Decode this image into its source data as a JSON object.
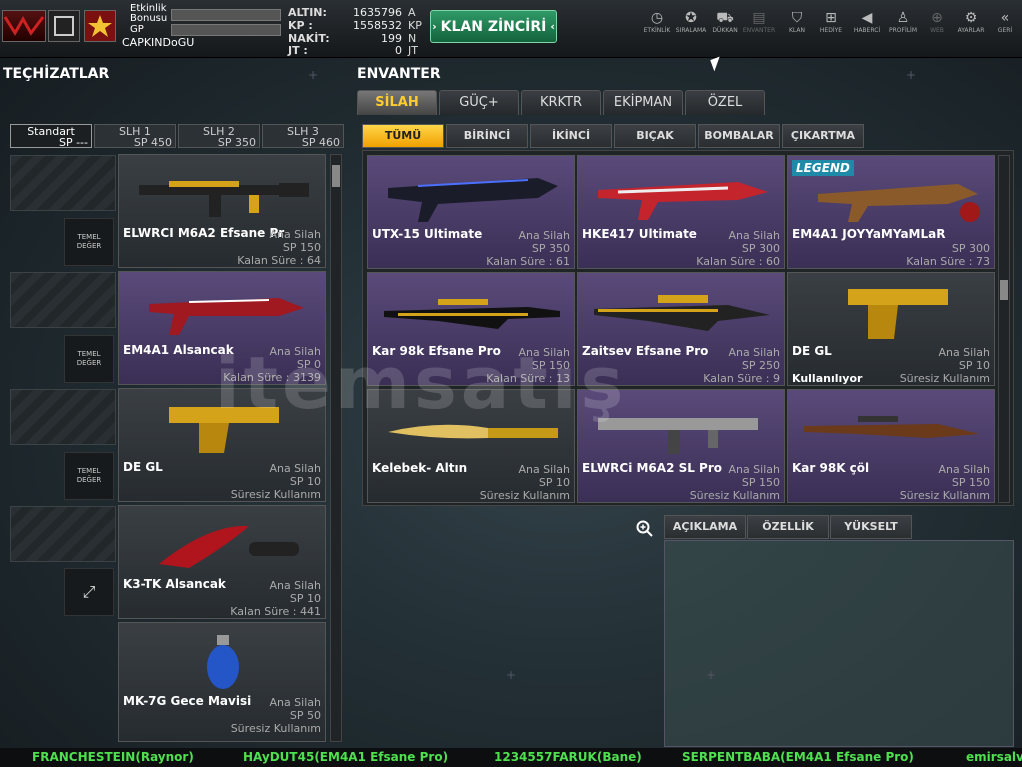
{
  "header": {
    "bonus_label": "Etkinlik Bonusu",
    "gp_label": "GP",
    "username": "CAPKINDoGU",
    "currencies": [
      {
        "label": "ALTIN:",
        "value": "1635796",
        "unit": "A"
      },
      {
        "label": "KP   :",
        "value": "1558532",
        "unit": "KP"
      },
      {
        "label": "NAKİT:",
        "value": "199",
        "unit": "N"
      },
      {
        "label": "JT   :",
        "value": "0",
        "unit": "JT"
      }
    ],
    "klan_button": "KLAN ZİNCİRİ",
    "nav": [
      "ETKİNLİK",
      "SIRALAMA",
      "DÜKKAN",
      "ENVANTER",
      "KLAN",
      "HEDİYE",
      "HABERCİ",
      "PROFİLİM",
      "WEB",
      "AYARLAR",
      "GERİ"
    ]
  },
  "left": {
    "title": "TEÇHİZATLAR",
    "slot_tabs": [
      {
        "name": "Standart",
        "sp": "SP ---"
      },
      {
        "name": "SLH 1",
        "sp": "SP 450"
      },
      {
        "name": "SLH 2",
        "sp": "SP 350"
      },
      {
        "name": "SLH 3",
        "sp": "SP 460"
      }
    ],
    "temel_label": "TEMEL DEĞER",
    "items": [
      {
        "name": "ELWRCI M6A2 Efsane Pr",
        "type": "Ana Silah",
        "sp": "SP 150",
        "time": "Kalan Süre : 64"
      },
      {
        "name": "EM4A1 Alsancak",
        "type": "Ana Silah",
        "sp": "SP 0",
        "time": "Kalan Süre : 3139"
      },
      {
        "name": "DE GL",
        "type": "Ana Silah",
        "sp": "SP 10",
        "time": "Süresiz Kullanım"
      },
      {
        "name": "K3-TK Alsancak",
        "type": "Ana Silah",
        "sp": "SP 10",
        "time": "Kalan Süre : 441"
      },
      {
        "name": "MK-7G Gece Mavisi",
        "type": "Ana Silah",
        "sp": "SP 50",
        "time": "Süresiz Kullanım"
      }
    ]
  },
  "inventory": {
    "title": "ENVANTER",
    "tabs": [
      "SİLAH",
      "GÜÇ+",
      "KRKTR",
      "EKİPMAN",
      "ÖZEL"
    ],
    "sub_tabs": [
      "TÜMÜ",
      "BİRİNCİ",
      "İKİNCİ",
      "BIÇAK",
      "BOMBALAR",
      "ÇIKARTMA"
    ],
    "items": [
      {
        "name": "UTX-15 Ultimate",
        "type": "Ana Silah",
        "sp": "SP 350",
        "time": "Kalan Süre : 61"
      },
      {
        "name": "HKE417 Ultimate",
        "type": "Ana Silah",
        "sp": "SP 300",
        "time": "Kalan Süre : 60"
      },
      {
        "name": "EM4A1 JOYYaMYaMLaR",
        "type": "",
        "sp": "SP 300",
        "time": "Kalan Süre : 73",
        "badge": "LEGEND"
      },
      {
        "name": "Kar 98k Efsane Pro",
        "type": "Ana Silah",
        "sp": "SP 150",
        "time": "Kalan Süre : 13"
      },
      {
        "name": "Zaitsev Efsane Pro",
        "type": "Ana Silah",
        "sp": "SP 250",
        "time": "Kalan Süre : 9"
      },
      {
        "name": "DE GL",
        "type": "Ana Silah",
        "sp": "SP 10",
        "time": "Süresiz Kullanım",
        "status": "Kullanılıyor"
      },
      {
        "name": "Kelebek- Altın",
        "type": "Ana Silah",
        "sp": "SP 10",
        "time": "Süresiz Kullanım"
      },
      {
        "name": "ELWRCi M6A2 SL Pro",
        "type": "Ana Silah",
        "sp": "SP 150",
        "time": "Süresiz Kullanım"
      },
      {
        "name": "Kar 98K çöl",
        "type": "Ana Silah",
        "sp": "SP 150",
        "time": "Süresiz Kullanım"
      }
    ],
    "info_tabs": [
      "AÇIKLAMA",
      "ÖZELLİK",
      "YÜKSELT"
    ]
  },
  "watermark": "itemsatış",
  "ticker": [
    "FRANCHESTEIN(Raynor)",
    "HAyDUT45(EM4A1 Efsane Pro)",
    "1234557FARUK(Bane)",
    "SERPENTBABA(EM4A1 Efsane Pro)",
    "emirsalv"
  ],
  "colors": {
    "accent": "#ffcc2e",
    "klan": "#1f7f50",
    "ticker": "#4fe04f",
    "rare": "#4e3f6e"
  }
}
